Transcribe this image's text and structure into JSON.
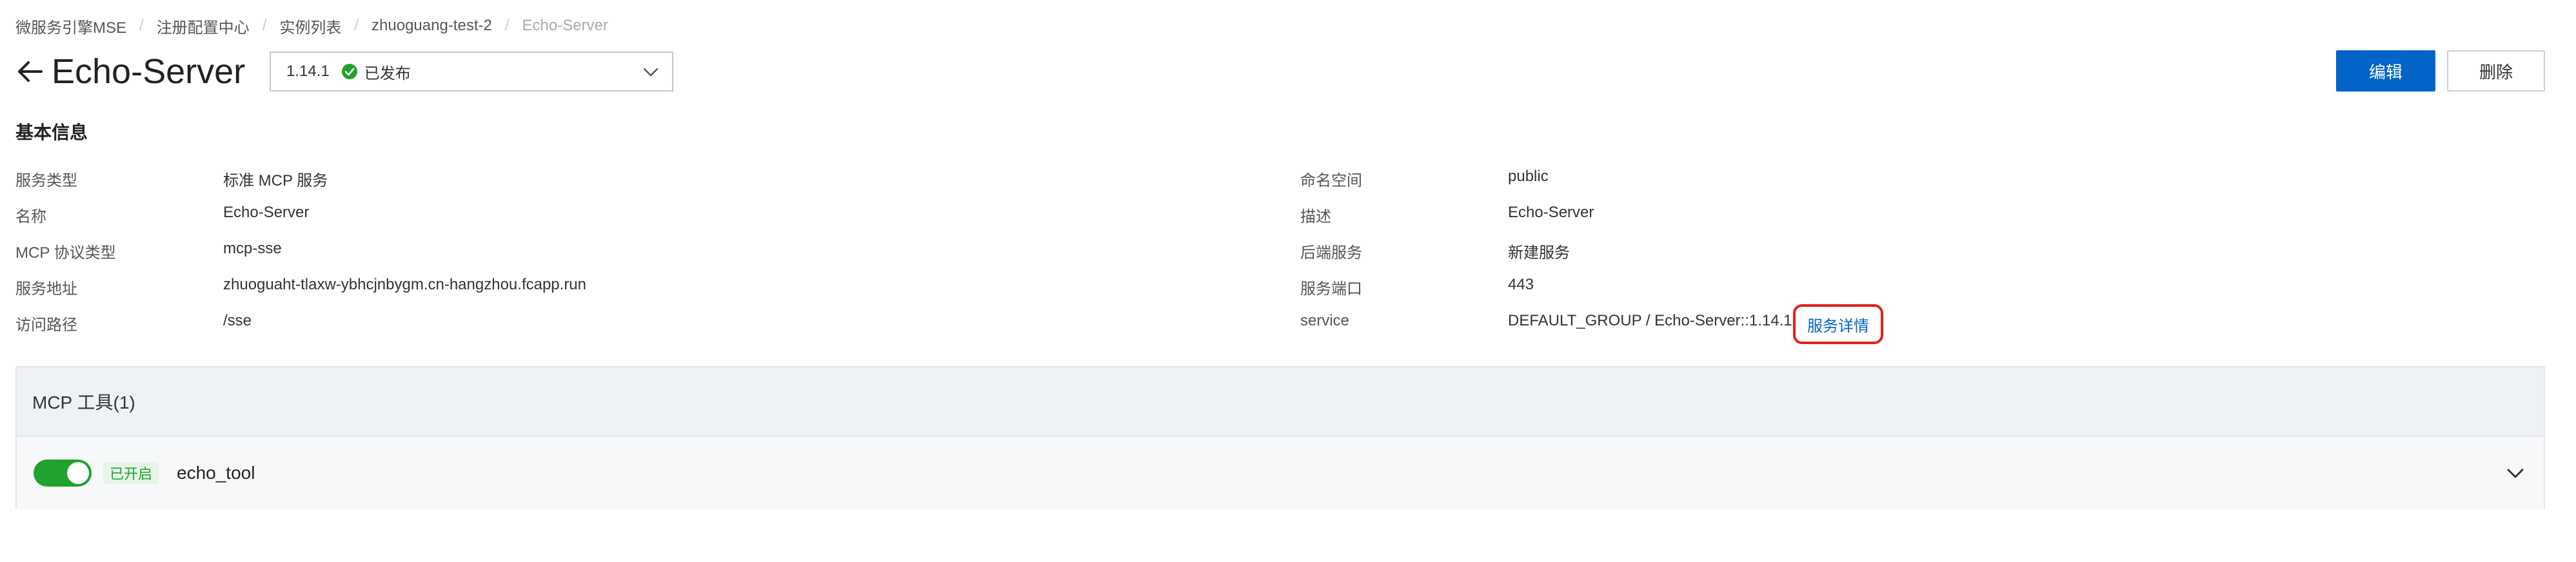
{
  "breadcrumb": {
    "items": [
      "微服务引擎MSE",
      "注册配置中心",
      "实例列表",
      "zhuoguang-test-2",
      "Echo-Server"
    ]
  },
  "header": {
    "title": "Echo-Server",
    "version": "1.14.1",
    "version_status": "已发布",
    "edit_label": "编辑",
    "delete_label": "删除"
  },
  "basic_info": {
    "title": "基本信息",
    "left": [
      {
        "label": "服务类型",
        "value": "标准 MCP 服务"
      },
      {
        "label": "名称",
        "value": "Echo-Server"
      },
      {
        "label": "MCP 协议类型",
        "value": "mcp-sse"
      },
      {
        "label": "服务地址",
        "value": "zhuoguaht-tlaxw-ybhcjnbygm.cn-hangzhou.fcapp.run"
      },
      {
        "label": "访问路径",
        "value": "/sse"
      }
    ],
    "right": [
      {
        "label": "命名空间",
        "value": "public"
      },
      {
        "label": "描述",
        "value": "Echo-Server"
      },
      {
        "label": "后端服务",
        "value": "新建服务"
      },
      {
        "label": "服务端口",
        "value": "443"
      },
      {
        "label": "service",
        "value": "DEFAULT_GROUP / Echo-Server::1.14.1"
      }
    ],
    "service_detail_link": "服务详情"
  },
  "tools": {
    "title": "MCP 工具(1)",
    "items": [
      {
        "enabled": true,
        "status": "已开启",
        "name": "echo_tool"
      }
    ]
  },
  "colors": {
    "primary": "#0064c8",
    "success": "#1fa32e",
    "highlight": "#e3201b"
  }
}
